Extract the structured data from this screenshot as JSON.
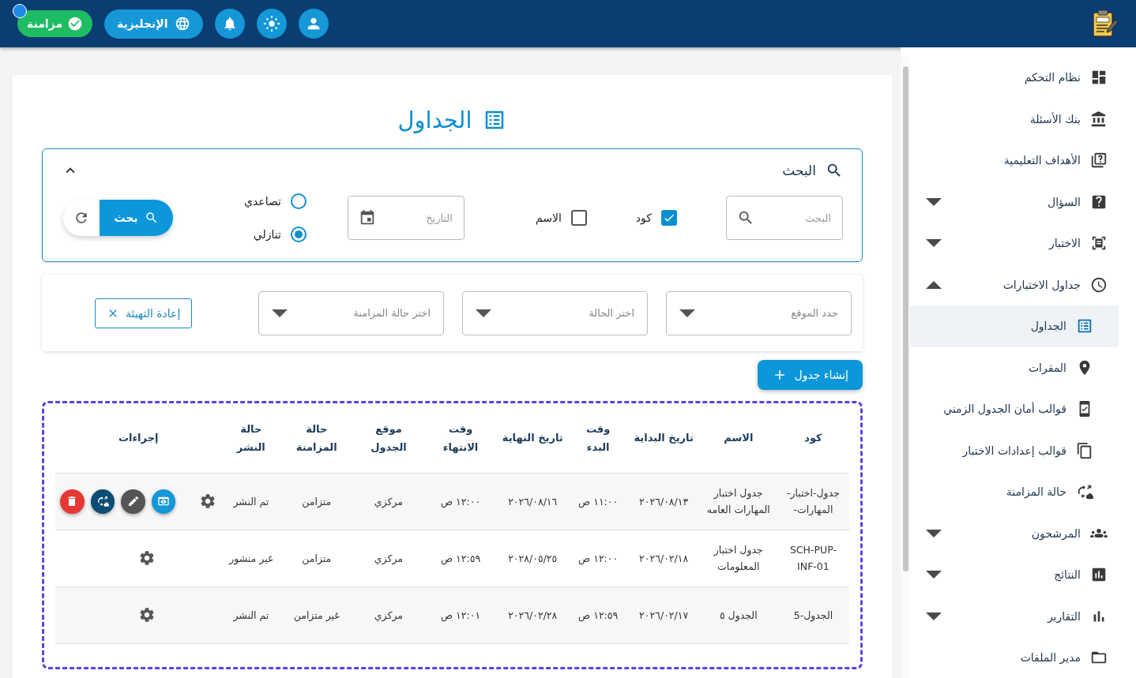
{
  "topbar": {
    "sync_status": {
      "label": "مزامنة",
      "online": true
    },
    "language_button": "الإنجليزية"
  },
  "sidebar": {
    "items": [
      {
        "label": "نظام التحكم",
        "selected": false
      },
      {
        "label": "بنك الأسئلة",
        "selected": false
      },
      {
        "label": "الأهداف التعليمية",
        "selected": false
      },
      {
        "label": "السؤال",
        "selected": false,
        "expanded": false
      },
      {
        "label": "الاختبار",
        "selected": false,
        "expanded": false
      },
      {
        "label": "جداول الاختبارات",
        "selected": false,
        "expanded": true,
        "children": [
          {
            "label": "الجداول",
            "selected": true
          },
          {
            "label": "المقرات",
            "selected": false
          },
          {
            "label": "قوالب أمان الجدول الزمني",
            "selected": false
          },
          {
            "label": "قوالب إعدادات الاختبار",
            "selected": false
          },
          {
            "label": "حالة المزامنة",
            "selected": false
          }
        ]
      },
      {
        "label": "المرشحون",
        "selected": false,
        "expanded": false
      },
      {
        "label": "النتائج",
        "selected": false,
        "expanded": false
      },
      {
        "label": "التقارير",
        "selected": false,
        "expanded": false
      },
      {
        "label": "مدير الملفات",
        "selected": false
      }
    ]
  },
  "page_title": "الجداول",
  "search_panel": {
    "title": "البحث",
    "expanded": true,
    "search_field": {
      "placeholder": "البحث"
    },
    "checkboxes": [
      {
        "label": "كود",
        "checked": true
      },
      {
        "label": "الاسم",
        "checked": false
      }
    ],
    "date_field": {
      "placeholder": "التاريخ"
    },
    "sort_options": [
      {
        "label": "تصاعدي",
        "selected": false
      },
      {
        "label": "تنازلي",
        "selected": true
      }
    ],
    "search_button": "بحث"
  },
  "filters": {
    "selects": [
      {
        "placeholder": "حدد الموقع"
      },
      {
        "placeholder": "اختر الحالة"
      },
      {
        "placeholder": "اختر حالة المزامنة"
      }
    ],
    "reset_button": "إعادة التهيئة"
  },
  "create_button": "إنشاء جدول",
  "table": {
    "columns": [
      "كود",
      "الاسم",
      "تاريخ البداية",
      "وقت البدء",
      "تاريخ النهاية",
      "وقت الانتهاء",
      "موقع الجدول",
      "حالة المزامنة",
      "حالة النشر",
      "إجراءات"
    ],
    "rows": [
      {
        "cells": [
          "جدول-اختبار-المهارات-",
          "جدول اختبار المهارات العامه",
          "٢٠٢٦/٠٨/١٣",
          "١١:٠٠ ص",
          "٢٠٢٦/٠٨/١٦",
          "١٢:٠٠ ص",
          "مركزي",
          "متزامن",
          "تم النشر"
        ],
        "actions_expanded": true
      },
      {
        "cells": [
          "SCH-PUP-INF-01",
          "جدول اختبار المعلومات",
          "٢٠٢٦/٠٢/١٨",
          "١٢:٠٠ ص",
          "٢٠٢٨/٠٥/٢٥",
          "١٢:٥٩ ص",
          "مركزي",
          "متزامن",
          "غير منشور"
        ],
        "actions_expanded": false
      },
      {
        "cells": [
          "الجدول-5",
          "الجدول ٥",
          "٢٠٢٦/٠٢/١٧",
          "١٢:٥٩ ص",
          "٢٠٢٦/٠٢/٢٨",
          "١٢:٠١ ص",
          "مركزي",
          "غير متزامن",
          "تم النشر"
        ],
        "actions_expanded": false
      }
    ]
  }
}
